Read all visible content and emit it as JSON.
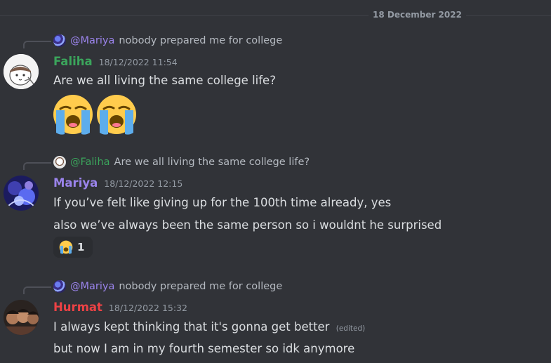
{
  "date_divider": "18 December 2022",
  "colors": {
    "faliha": "#3ba55c",
    "mariya": "#9b84ec",
    "hurmat": "#ed4245"
  },
  "messages": [
    {
      "reply": {
        "name": "@Mariya",
        "text": "nobody prepared me for college",
        "avatar_icon": "flower-avatar-icon"
      },
      "author": "Faliha",
      "timestamp": "18/12/2022 11:54",
      "lines": [
        "Are we all living the same college life?"
      ],
      "jumbo_emoji": [
        "loudly-crying-face-icon",
        "loudly-crying-face-icon"
      ]
    },
    {
      "reply": {
        "name": "@Faliha",
        "text": "Are we all living the same college life?",
        "avatar_icon": "cartoon-avatar-icon"
      },
      "author": "Mariya",
      "timestamp": "18/12/2022 12:15",
      "lines": [
        "If you’ve felt like giving up for the 100th time already, yes",
        "also we’ve always been the same person so i wouldnt he surprised"
      ],
      "reaction": {
        "emoji": "loudly-crying-face-icon",
        "count": "1"
      }
    },
    {
      "reply": {
        "name": "@Mariya",
        "text": "nobody prepared me for college",
        "avatar_icon": "flower-avatar-icon"
      },
      "author": "Hurmat",
      "timestamp": "18/12/2022 15:32",
      "lines": [
        "I always kept thinking that it's gonna get better",
        "but now I am in my fourth semester so idk anymore"
      ],
      "edited_label": "(edited)"
    }
  ]
}
